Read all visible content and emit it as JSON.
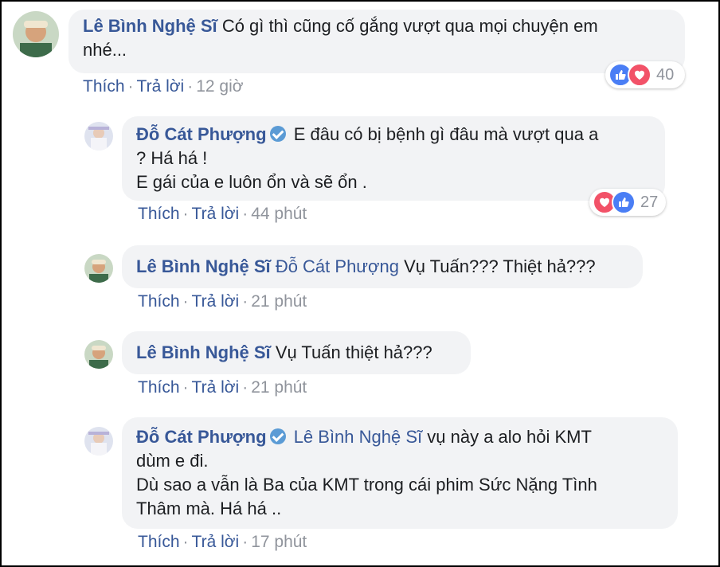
{
  "colors": {
    "link": "#385898",
    "bubble": "#f2f3f5",
    "meta": "#90949c",
    "like": "#4a7ef5",
    "love": "#f25268"
  },
  "comments": [
    {
      "author": "Lê Bình Nghệ Sĩ",
      "line1": "Có gì thì cũng cố gắng vượt qua mọi chuyện em",
      "line2": "nhé...",
      "like_label": "Thích",
      "reply_label": "Trả lời",
      "time": "12 giờ",
      "reactions": {
        "icons": [
          "like-icon",
          "love-icon"
        ],
        "count": "40"
      }
    },
    {
      "author": "Đỗ Cát Phượng",
      "verified": true,
      "line1": "E đâu có bị bệnh gì đâu mà vượt qua a",
      "line2": "? Há há !",
      "line3": "E gái của e luôn ổn và sẽ ổn .",
      "like_label": "Thích",
      "reply_label": "Trả lời",
      "time": "44 phút",
      "reactions": {
        "icons": [
          "love-icon",
          "like-icon"
        ],
        "count": "27"
      }
    },
    {
      "author": "Lê Bình Nghệ Sĩ",
      "tag": "Đỗ Cát Phượng",
      "line1": "Vụ Tuấn??? Thiệt hả???",
      "like_label": "Thích",
      "reply_label": "Trả lời",
      "time": "21 phút"
    },
    {
      "author": "Lê Bình Nghệ Sĩ",
      "line1": "Vụ Tuấn thiệt hả???",
      "like_label": "Thích",
      "reply_label": "Trả lời",
      "time": "21 phút"
    },
    {
      "author": "Đỗ Cát Phượng",
      "verified": true,
      "tag": "Lê Bình Nghệ Sĩ",
      "line1": "vụ này a alo hỏi KMT",
      "line2": "dùm e đi.",
      "line3": "Dù sao a vẫn là Ba của KMT trong cái phim Sức Nặng Tình",
      "line4": "Thâm mà. Há há ..",
      "like_label": "Thích",
      "reply_label": "Trả lời",
      "time": "17 phút"
    }
  ]
}
